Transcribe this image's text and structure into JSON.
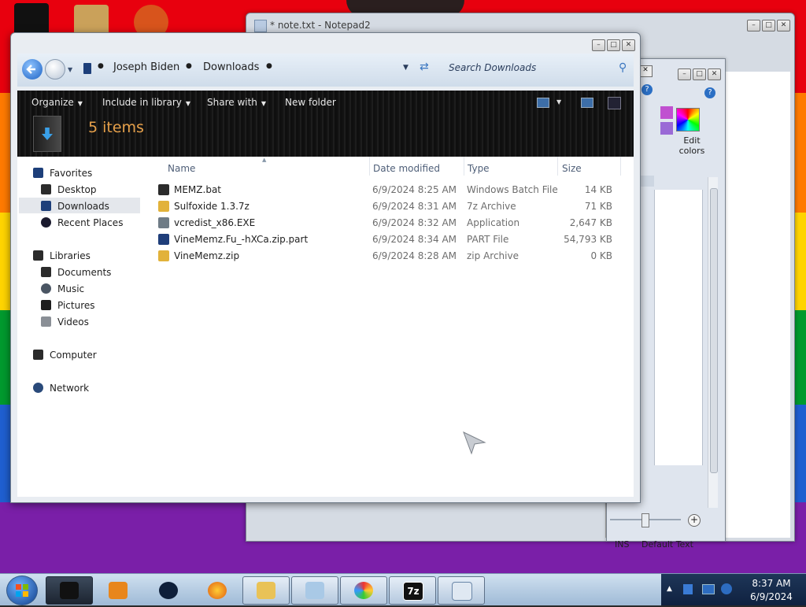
{
  "wallpaper_colors": [
    "#e8000e",
    "#ff7a00",
    "#ffd400",
    "#009a2e",
    "#1f5fd0",
    "#7a1fa8"
  ],
  "notepad": {
    "title": "* note.txt - Notepad2"
  },
  "paint": {
    "edit_colors_label": "Edit colors",
    "status_ins": "INS",
    "status_text": "Default Text"
  },
  "explorer": {
    "breadcrumb": [
      "Joseph Biden",
      "Downloads"
    ],
    "search_placeholder": "Search Downloads",
    "toolbar": {
      "organize": "Organize",
      "include_in_library": "Include in library",
      "share_with": "Share with",
      "new_folder": "New folder"
    },
    "items_count": "5 items",
    "nav": {
      "favorites": "Favorites",
      "desktop": "Desktop",
      "downloads": "Downloads",
      "recent_places": "Recent Places",
      "libraries": "Libraries",
      "documents": "Documents",
      "music": "Music",
      "pictures": "Pictures",
      "videos": "Videos",
      "computer": "Computer",
      "network": "Network"
    },
    "columns": {
      "name": "Name",
      "date_modified": "Date modified",
      "type": "Type",
      "size": "Size"
    },
    "files": [
      {
        "name": "MEMZ.bat",
        "date": "6/9/2024 8:25 AM",
        "type": "Windows Batch File",
        "size": "14 KB",
        "icon": "batch-file-icon",
        "color": "#2b2b2b"
      },
      {
        "name": "Sulfoxide 1.3.7z",
        "date": "6/9/2024 8:31 AM",
        "type": "7z Archive",
        "size": "71 KB",
        "icon": "archive-icon",
        "color": "#e2b23a"
      },
      {
        "name": "vcredist_x86.EXE",
        "date": "6/9/2024 8:32 AM",
        "type": "Application",
        "size": "2,647 KB",
        "icon": "application-icon",
        "color": "#6f7c86"
      },
      {
        "name": "VineMemz.Fu_-hXCa.zip.part",
        "date": "6/9/2024 8:34 AM",
        "type": "PART File",
        "size": "54,793 KB",
        "icon": "part-file-icon",
        "color": "#1f3e7a"
      },
      {
        "name": "VineMemz.zip",
        "date": "6/9/2024 8:28 AM",
        "type": "zip Archive",
        "size": "0 KB",
        "icon": "zip-icon",
        "color": "#e2b23a"
      }
    ]
  },
  "taskbar": {
    "time": "8:37 AM",
    "date": "6/9/2024"
  }
}
